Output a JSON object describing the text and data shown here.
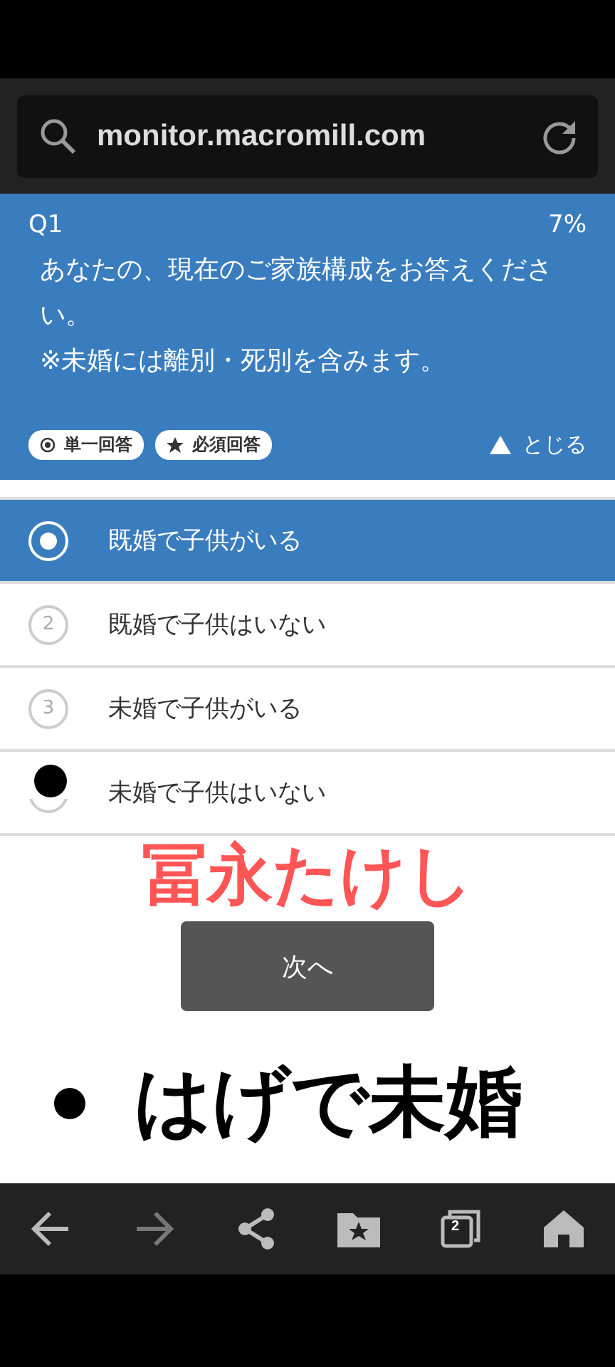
{
  "address_bar": {
    "url": "monitor.macromill.com"
  },
  "question": {
    "number": "Q1",
    "progress": "7%",
    "text": "あなたの、現在のご家族構成をお答えください。",
    "note": "※未婚には離別・死別を含みます。",
    "tags": [
      {
        "kind": "single",
        "label": "単一回答"
      },
      {
        "kind": "required",
        "label": "必須回答"
      }
    ],
    "collapse": "とじる"
  },
  "options": [
    {
      "label": "既婚で子供がいる",
      "selected": true,
      "covered": false
    },
    {
      "label": "既婚で子供はいない",
      "number": "2",
      "selected": false,
      "covered": false
    },
    {
      "label": "未婚で子供がいる",
      "number": "3",
      "selected": false,
      "covered": false
    },
    {
      "label": "未婚で子供はいない",
      "selected": false,
      "covered": true
    }
  ],
  "overlay_name": "冨永たけし",
  "next_button": "次へ",
  "overlay_note": "はげで未婚",
  "bottom_bar": [
    {
      "kind": "back",
      "disabled": false
    },
    {
      "kind": "forward",
      "disabled": true
    },
    {
      "kind": "share",
      "disabled": false
    },
    {
      "kind": "bookmarks",
      "disabled": false
    },
    {
      "kind": "tabs",
      "count": "2",
      "disabled": false
    },
    {
      "kind": "home",
      "disabled": false
    }
  ]
}
